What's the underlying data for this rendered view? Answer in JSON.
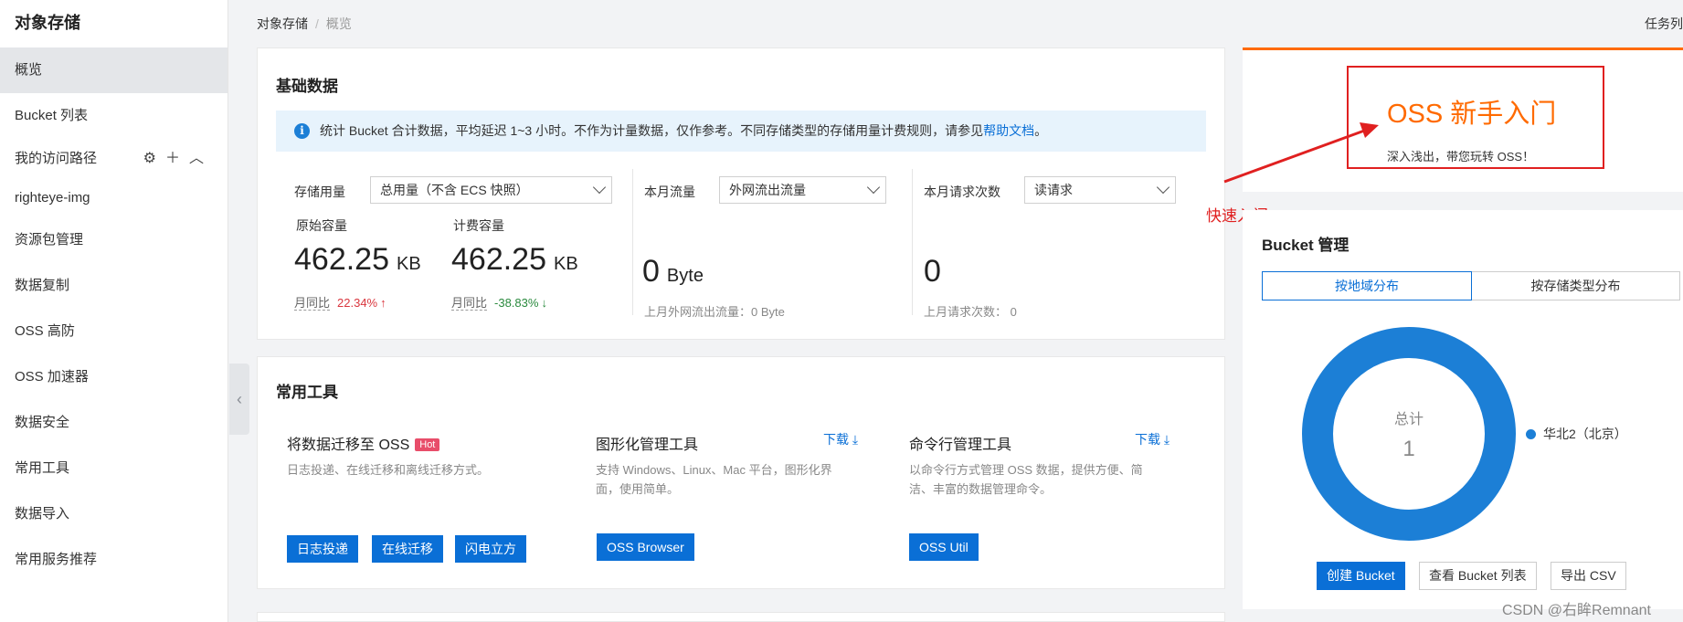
{
  "sidebar": {
    "title": "对象存储",
    "items": [
      {
        "label": "概览",
        "active": true
      },
      {
        "label": "Bucket 列表"
      }
    ],
    "access_path": {
      "label": "我的访问路径",
      "items": [
        "righteye-img"
      ]
    },
    "more_items": [
      "资源包管理",
      "数据复制",
      "OSS 高防",
      "OSS 加速器",
      "数据安全",
      "常用工具",
      "数据导入",
      "常用服务推荐"
    ]
  },
  "header": {
    "breadcrumb": [
      "对象存储",
      "概览"
    ],
    "task_link": "任务列"
  },
  "basic": {
    "title": "基础数据",
    "info_text": "统计 Bucket 合计数据，平均延迟 1~3 小时。不作为计量数据，仅作参考。不同存储类型的存储用量计费规则，请参见",
    "info_link": "帮助文档",
    "info_tail": "。",
    "storage": {
      "label": "存储用量",
      "select": "总用量（不含 ECS 快照）",
      "raw_label": "原始容量",
      "raw_value": "462.25",
      "raw_unit": "KB",
      "raw_cmp_label": "月同比",
      "raw_cmp_value": "22.34%",
      "bill_label": "计费容量",
      "bill_value": "462.25",
      "bill_unit": "KB",
      "bill_cmp_label": "月同比",
      "bill_cmp_value": "-38.83%"
    },
    "traffic": {
      "label": "本月流量",
      "select": "外网流出流量",
      "value": "0",
      "unit": "Byte",
      "last": "上月外网流出流量：0 Byte"
    },
    "requests": {
      "label": "本月请求次数",
      "select": "读请求",
      "value": "0",
      "last": "上月请求次数： 0"
    }
  },
  "tools": {
    "title": "常用工具",
    "migrate": {
      "title": "将数据迁移至 OSS",
      "badge": "Hot",
      "desc": "日志投递、在线迁移和离线迁移方式。",
      "buttons": [
        "日志投递",
        "在线迁移",
        "闪电立方"
      ]
    },
    "gui": {
      "title": "图形化管理工具",
      "download": "下载",
      "desc1": "支持 Windows、Linux、Mac 平台，图形化界",
      "desc2": "面，使用简单。",
      "button": "OSS Browser"
    },
    "cli": {
      "title": "命令行管理工具",
      "download": "下载",
      "desc1": "以命令行方式管理 OSS 数据，提供方便、简",
      "desc2": "洁、丰富的数据管理命令。",
      "button": "OSS Util"
    }
  },
  "oss_intro": {
    "title": "OSS 新手入门",
    "subtitle": "深入浅出，带您玩转 OSS！"
  },
  "annotation": "快速入门",
  "bucket": {
    "title": "Bucket 管理",
    "tabs": [
      {
        "label": "按地域分布",
        "active": true
      },
      {
        "label": "按存储类型分布"
      }
    ],
    "donut_label": "总计",
    "donut_value": "1",
    "legend": "华北2（北京）",
    "buttons": {
      "create": "创建 Bucket",
      "list": "查看 Bucket 列表",
      "csv": "导出 CSV"
    }
  },
  "watermark": "CSDN @右眸Remnant",
  "colors": {
    "primary": "#0a6fd6",
    "accent": "#ff6a00",
    "annotation": "#e02020",
    "donut": "#1c7fd6"
  }
}
